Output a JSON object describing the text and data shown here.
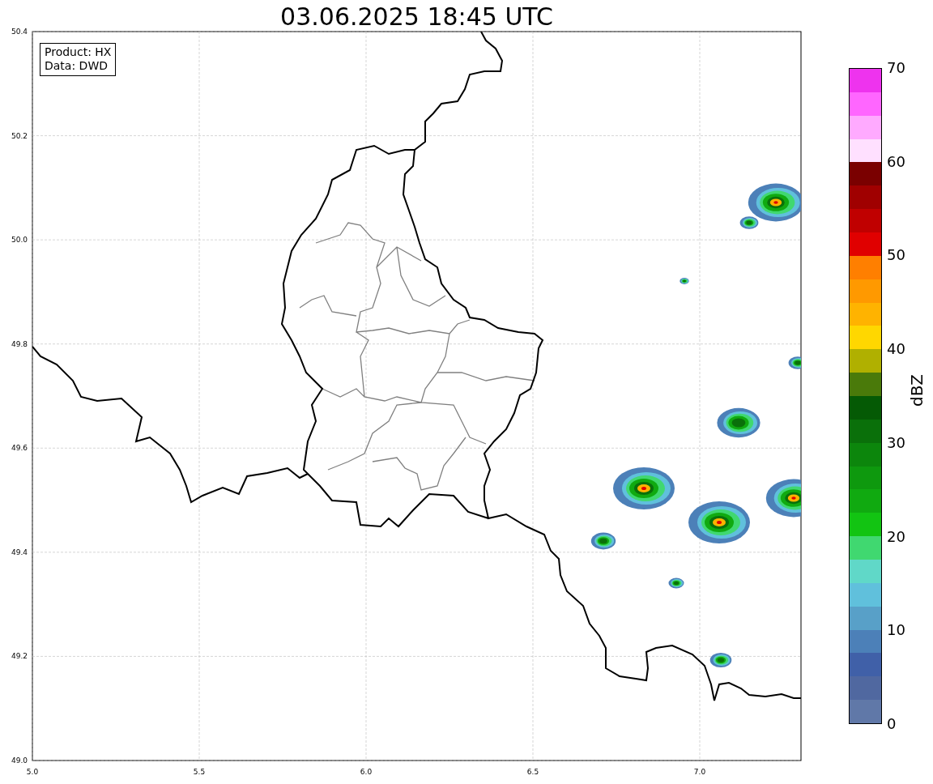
{
  "title": "03.06.2025 18:45 UTC",
  "info_box": {
    "lines": [
      "Product: HX",
      "Data: DWD"
    ]
  },
  "x_axis": {
    "ticks": [
      "5.0",
      "5.5",
      "6.0",
      "6.5",
      "7.0"
    ]
  },
  "y_axis": {
    "ticks": [
      "50.4",
      "50.2",
      "50.0",
      "49.8",
      "49.6",
      "49.4",
      "49.2",
      "49.0"
    ]
  },
  "colorbar": {
    "label": "dBZ",
    "ticks": [
      "70",
      "60",
      "50",
      "40",
      "30",
      "20",
      "10",
      "0"
    ],
    "bands": [
      {
        "color": "#ee33ee"
      },
      {
        "color": "#ff66ff"
      },
      {
        "color": "#ffaaff"
      },
      {
        "color": "#ffe0ff"
      },
      {
        "color": "#7a0000"
      },
      {
        "color": "#a00000"
      },
      {
        "color": "#c00000"
      },
      {
        "color": "#e00000"
      },
      {
        "color": "#ff7f00"
      },
      {
        "color": "#ff9900"
      },
      {
        "color": "#ffb300"
      },
      {
        "color": "#ffd700"
      },
      {
        "color": "#b0b000"
      },
      {
        "color": "#4a7a0a"
      },
      {
        "color": "#055a05"
      },
      {
        "color": "#0a700a"
      },
      {
        "color": "#0c860c"
      },
      {
        "color": "#0e990e"
      },
      {
        "color": "#10aa10"
      },
      {
        "color": "#12c412"
      },
      {
        "color": "#40d870"
      },
      {
        "color": "#60d8c8"
      },
      {
        "color": "#60c0dc"
      },
      {
        "color": "#58a0c8"
      },
      {
        "color": "#4c80b8"
      },
      {
        "color": "#4060a8"
      },
      {
        "color": "#5068a0"
      },
      {
        "color": "#6078a8"
      }
    ]
  }
}
